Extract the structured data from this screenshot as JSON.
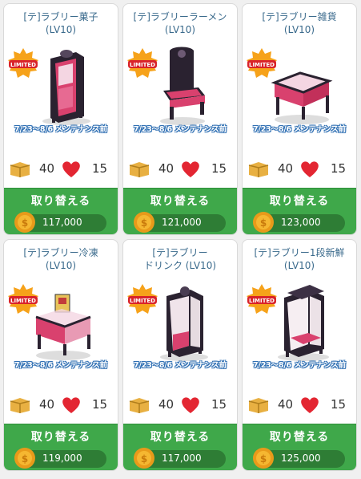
{
  "badge_label": "LIMITED",
  "maintenance_note": "7/23～8/6 メンテナンス前",
  "exchange_label": "取り替える",
  "colors": {
    "title": "#3a6a8c",
    "exchange_bg": "#3fa84a",
    "price_pill": "#2e7d35",
    "heart": "#e32632",
    "note_outline": "#2f6fb3"
  },
  "items": [
    {
      "title": "[テ]ラブリー菓子\n(LV10)",
      "box": "40",
      "hearts": "15",
      "price": "117,000",
      "icon": "cabinet-icon"
    },
    {
      "title": "[テ]ラブリーラーメン\n(LV10)",
      "box": "40",
      "hearts": "15",
      "price": "121,000",
      "icon": "chair-icon"
    },
    {
      "title": "[テ]ラブリー雑貨\n(LV10)",
      "box": "40",
      "hearts": "15",
      "price": "123,000",
      "icon": "display-table-icon"
    },
    {
      "title": "[テ]ラブリー冷凍\n(LV10)",
      "box": "40",
      "hearts": "15",
      "price": "119,000",
      "icon": "freezer-icon"
    },
    {
      "title": "[テ]ラブリー\nドリンク (LV10)",
      "box": "40",
      "hearts": "15",
      "price": "117,000",
      "icon": "drink-case-icon"
    },
    {
      "title": "[テ]ラブリー1段新鮮\n(LV10)",
      "box": "40",
      "hearts": "15",
      "price": "125,000",
      "icon": "fresh-case-icon"
    }
  ]
}
